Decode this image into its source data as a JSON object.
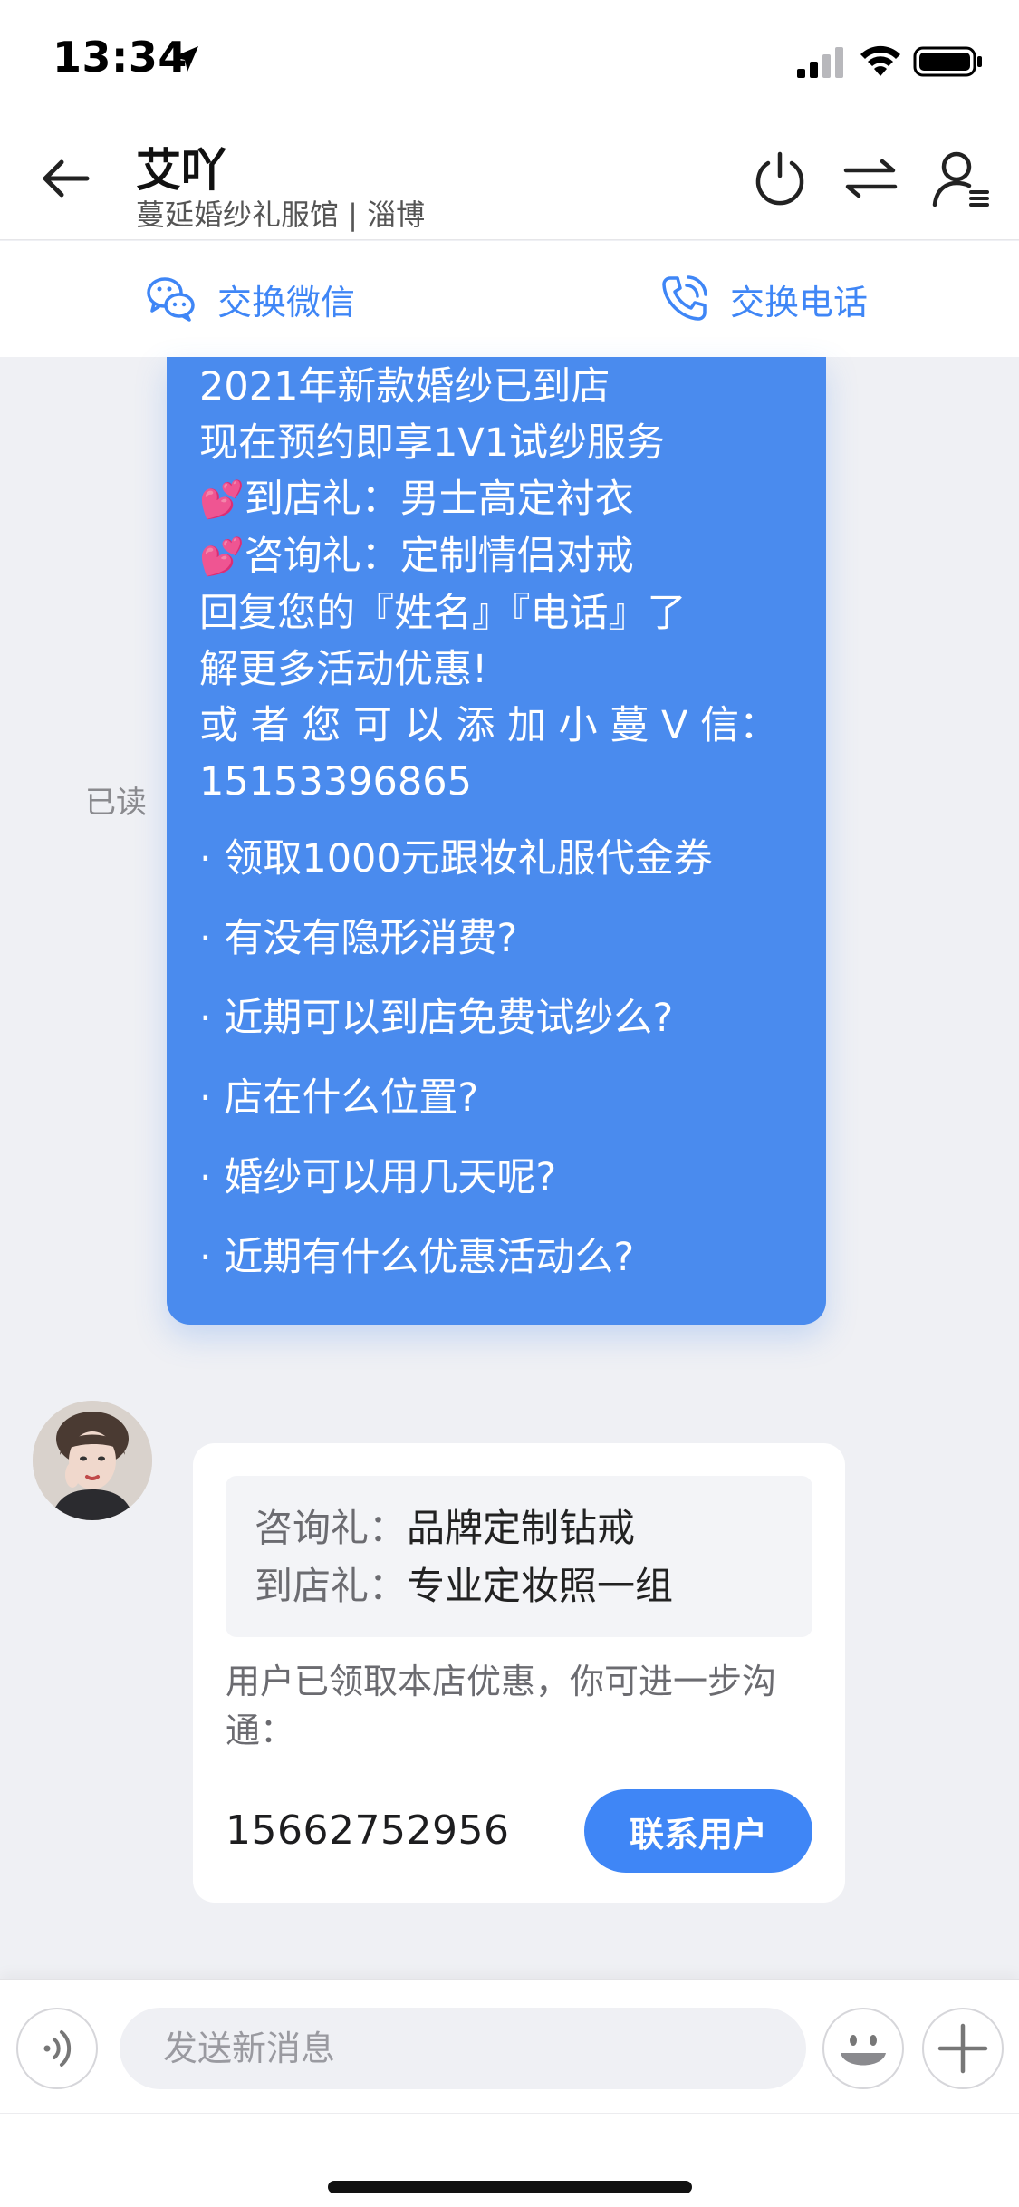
{
  "status_bar": {
    "time": "13:34"
  },
  "header": {
    "title": "艾吖",
    "subtitle": "蔓延婚纱礼服馆 | 淄博"
  },
  "exchange": {
    "wechat_label": "交换微信",
    "phone_label": "交换电话"
  },
  "outgoing_message": {
    "read_status": "已读",
    "lines": [
      "2021年新款婚纱已到店",
      "现在预约即享1V1试纱服务"
    ],
    "gift_lines": [
      {
        "emoji": "💕",
        "text": "到店礼：男士高定衬衣"
      },
      {
        "emoji": "💕",
        "text": "咨询礼：定制情侣对戒"
      }
    ],
    "reply_lines": [
      "回复您的『姓名』『电话』了",
      "解更多活动优惠!",
      "或 者 您 可 以 添 加 小 蔓 V 信：",
      "15153396865"
    ],
    "faq": [
      "· 领取1000元跟妆礼服代金券",
      "· 有没有隐形消费?",
      "· 近期可以到店免费试纱么?",
      "· 店在什么位置?",
      "· 婚纱可以用几天呢?",
      "· 近期有什么优惠活动么?"
    ]
  },
  "incoming_card": {
    "promo": [
      {
        "key": "咨询礼：",
        "value": "品牌定制钻戒"
      },
      {
        "key": "到店礼：",
        "value": "专业定妆照一组"
      }
    ],
    "note": "用户已领取本店优惠，你可进一步沟通：",
    "user_phone": "15662752956",
    "contact_button": "联系用户"
  },
  "input_bar": {
    "placeholder": "发送新消息"
  },
  "colors": {
    "accent": "#3f86f6",
    "bubble": "#4a8bee",
    "background": "#eff0f4"
  },
  "icons": [
    "location-arrow-icon",
    "signal-icon",
    "wifi-icon",
    "battery-icon",
    "back-arrow-icon",
    "power-icon",
    "swap-icon",
    "user-menu-icon",
    "wechat-icon",
    "phone-call-icon",
    "voice-icon",
    "emoji-icon",
    "plus-icon"
  ]
}
